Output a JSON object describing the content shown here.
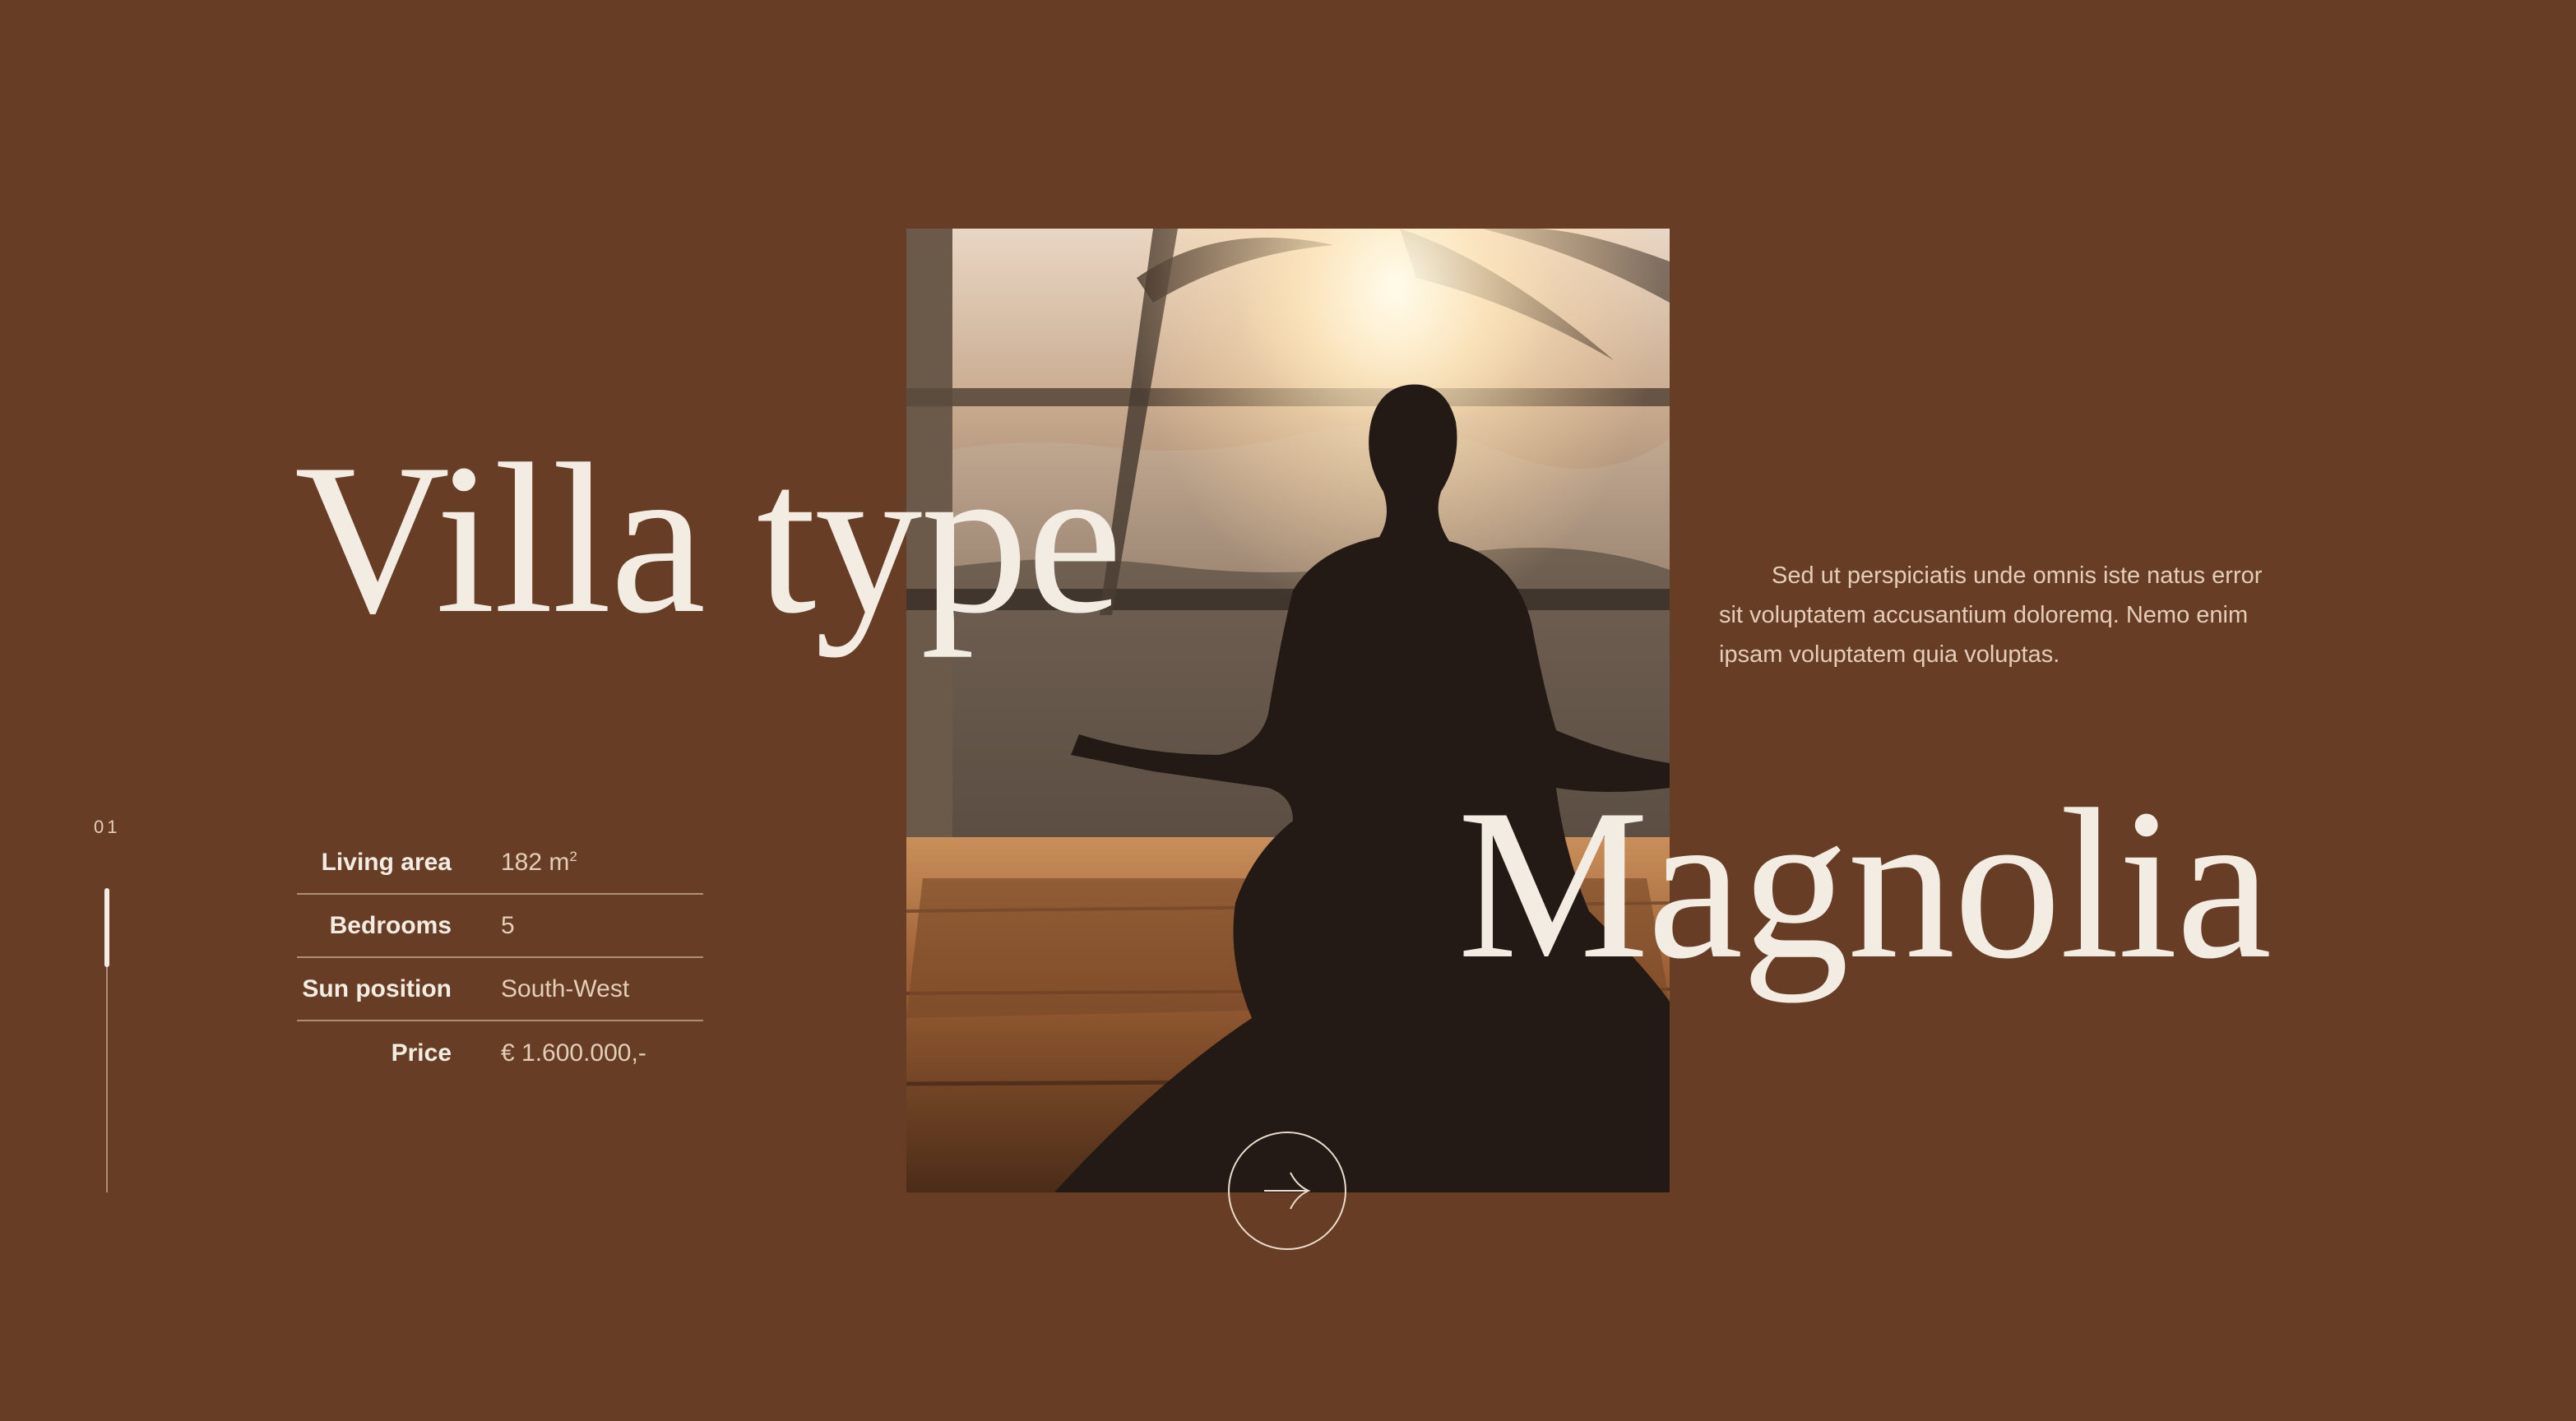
{
  "hero": {
    "title_line_1": "Villa type",
    "title_line_2": "Magnolia"
  },
  "description": "Sed ut perspiciatis unde omnis iste natus error sit voluptatem accusantium doloremq. Nemo enim ipsam voluptatem quia voluptas.",
  "slider": {
    "current_index": "01"
  },
  "specs": [
    {
      "label": "Living area",
      "value": "182 m",
      "unit_sup": "2"
    },
    {
      "label": "Bedrooms",
      "value": "5"
    },
    {
      "label": "Sun position",
      "value": "South-West"
    },
    {
      "label": "Price",
      "value": "€ 1.600.000,-"
    }
  ],
  "icons": {
    "next": "arrow-right-icon"
  },
  "colors": {
    "background": "#683d26",
    "text_light": "#f3ece3",
    "text_muted": "#e4cdb9"
  }
}
